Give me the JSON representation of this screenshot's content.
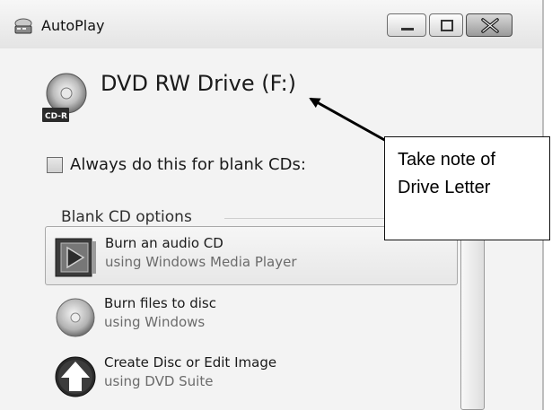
{
  "window": {
    "title": "AutoPlay"
  },
  "device": {
    "name": "DVD RW Drive (F:)",
    "badge": "CD-R"
  },
  "checkbox": {
    "label": "Always do this for blank CDs:",
    "checked": false
  },
  "section": {
    "label": "Blank CD options"
  },
  "options": [
    {
      "title": "Burn an audio CD",
      "subtitle": "using Windows Media Player",
      "icon": "media-player-icon",
      "selected": true
    },
    {
      "title": "Burn files to disc",
      "subtitle": "using Windows",
      "icon": "disc-icon",
      "selected": false
    },
    {
      "title": "Create Disc or Edit Image",
      "subtitle": "using DVD Suite",
      "icon": "up-arrow-disc-icon",
      "selected": false
    }
  ],
  "annotation": {
    "text": "Take note of\nDrive Letter"
  },
  "colors": {
    "accent": "#d6d6d6",
    "arrow": "#000000"
  }
}
